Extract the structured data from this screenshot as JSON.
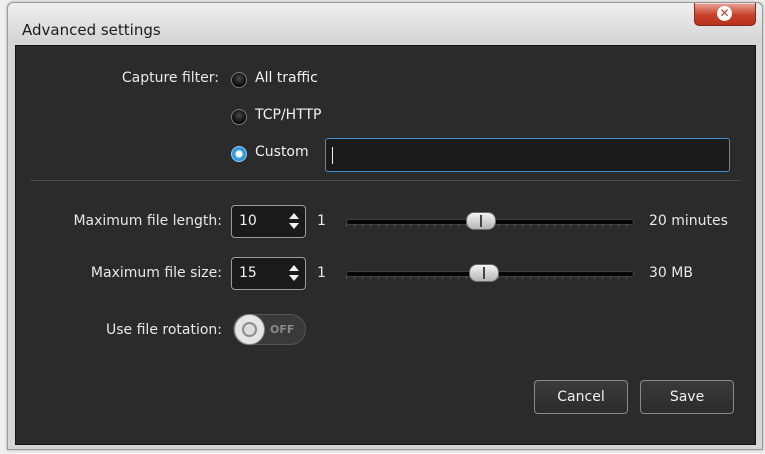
{
  "window": {
    "title": "Advanced settings"
  },
  "capture_filter": {
    "label": "Capture filter:",
    "options": [
      {
        "label": "All traffic",
        "checked": false
      },
      {
        "label": "TCP/HTTP",
        "checked": false
      },
      {
        "label": "Custom",
        "checked": true
      }
    ],
    "custom_value": ""
  },
  "file_length": {
    "label": "Maximum file length:",
    "value": "10",
    "min_label": "1",
    "max_label": "20 minutes",
    "slider_fraction": 0.47
  },
  "file_size": {
    "label": "Maximum file size:",
    "value": "15",
    "min_label": "1",
    "max_label": "30 MB",
    "slider_fraction": 0.48
  },
  "rotation": {
    "label": "Use file rotation:",
    "state": "OFF"
  },
  "buttons": {
    "cancel": "Cancel",
    "save": "Save"
  },
  "colors": {
    "accent": "#3aa6e6",
    "panel": "#2b2b2b",
    "close": "#c7402b"
  }
}
